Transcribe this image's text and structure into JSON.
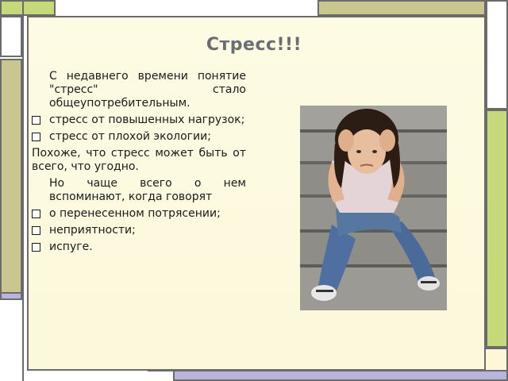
{
  "slide": {
    "title": "Стресс!!!",
    "paragraphs": [
      {
        "kind": "indent",
        "text": "С недавнего времени понятие \"стресс\" стало общеупотребительным."
      },
      {
        "kind": "bullet",
        "text": "стресс от повышенных нагрузок;"
      },
      {
        "kind": "bullet",
        "text": "стресс от плохой экологии;"
      },
      {
        "kind": "plain",
        "text": "Похоже, что стресс может быть от всего, что угодно."
      },
      {
        "kind": "indent",
        "text": "Но чаще всего о нем вспоминают, когда говорят"
      },
      {
        "kind": "bullet",
        "text": "о перенесенном потрясении;"
      },
      {
        "kind": "bullet",
        "text": "неприятности;"
      },
      {
        "kind": "bullet",
        "text": "испуге."
      }
    ]
  },
  "colors": {
    "frame_green": "#c5d97a",
    "frame_olive": "#c9c78f",
    "frame_lavender": "#b8b4dc",
    "slide_background": "#fbf8db",
    "title_color": "#6a6d73"
  }
}
